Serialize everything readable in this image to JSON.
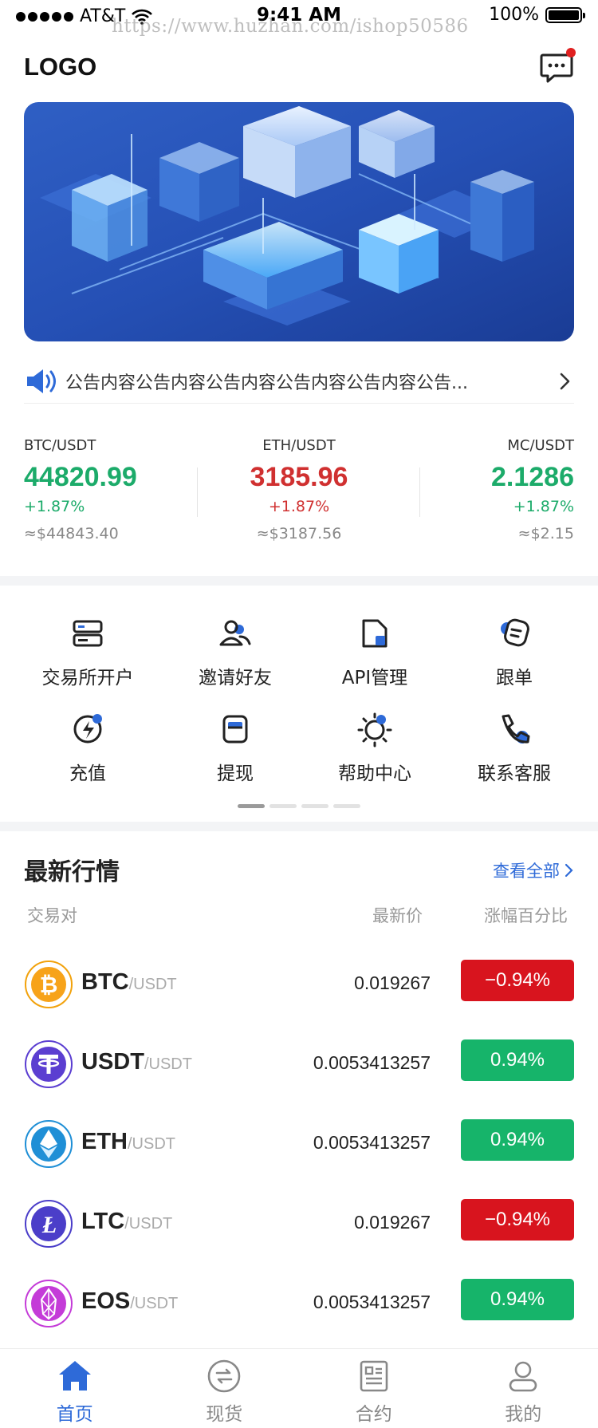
{
  "status_bar": {
    "carrier": "AT&T",
    "time": "9:41 AM",
    "battery": "100%",
    "watermark": "https://www.huzhan.com/ishop50586"
  },
  "header": {
    "logo": "LOGO",
    "message_icon": "chat-icon"
  },
  "notice": {
    "text": "公告内容公告内容公告内容公告内容公告内容公告...",
    "icon": "speaker-icon"
  },
  "tickers": [
    {
      "pair": "BTC/USDT",
      "price": "44820.99",
      "change": "+1.87%",
      "usd": "≈$44843.40",
      "color": "#1cab6a"
    },
    {
      "pair": "ETH/USDT",
      "price": "3185.96",
      "change": "+1.87%",
      "usd": "≈$3187.56",
      "color": "#d03030"
    },
    {
      "pair": "MC/USDT",
      "price": "2.1286",
      "change": "+1.87%",
      "usd": "≈$2.15",
      "color": "#1cab6a"
    }
  ],
  "menu": [
    {
      "label": "交易所开户",
      "icon": "exchange-account-icon"
    },
    {
      "label": "邀请好友",
      "icon": "invite-friends-icon"
    },
    {
      "label": "API管理",
      "icon": "api-icon"
    },
    {
      "label": "跟单",
      "icon": "copy-trade-icon"
    },
    {
      "label": "充值",
      "icon": "deposit-icon"
    },
    {
      "label": "提现",
      "icon": "withdraw-icon"
    },
    {
      "label": "帮助中心",
      "icon": "help-icon"
    },
    {
      "label": "联系客服",
      "icon": "support-phone-icon"
    }
  ],
  "market": {
    "title": "最新行情",
    "view_all": "查看全部",
    "col_pair": "交易对",
    "col_price": "最新价",
    "col_change": "涨幅百分比",
    "rows": [
      {
        "coin": "BTC",
        "quote": "/USDT",
        "price": "0.019267",
        "change": "−0.94%",
        "trend": "down",
        "logo": "btc-logo-icon"
      },
      {
        "coin": "USDT",
        "quote": "/USDT",
        "price": "0.0053413257",
        "change": "0.94%",
        "trend": "up",
        "logo": "usdt-logo-icon"
      },
      {
        "coin": "ETH",
        "quote": "/USDT",
        "price": "0.0053413257",
        "change": "0.94%",
        "trend": "up",
        "logo": "eth-logo-icon"
      },
      {
        "coin": "LTC",
        "quote": "/USDT",
        "price": "0.019267",
        "change": "−0.94%",
        "trend": "down",
        "logo": "ltc-logo-icon"
      },
      {
        "coin": "EOS",
        "quote": "/USDT",
        "price": "0.0053413257",
        "change": "0.94%",
        "trend": "up",
        "logo": "eos-logo-icon"
      }
    ]
  },
  "tabbar": [
    {
      "label": "首页",
      "icon": "home-icon",
      "active": true
    },
    {
      "label": "现货",
      "icon": "spot-icon",
      "active": false
    },
    {
      "label": "合约",
      "icon": "contract-icon",
      "active": false
    },
    {
      "label": "我的",
      "icon": "profile-icon",
      "active": false
    }
  ],
  "colors": {
    "accent": "#2e6ad8",
    "up": "#16b46a",
    "down": "#d8141e"
  }
}
